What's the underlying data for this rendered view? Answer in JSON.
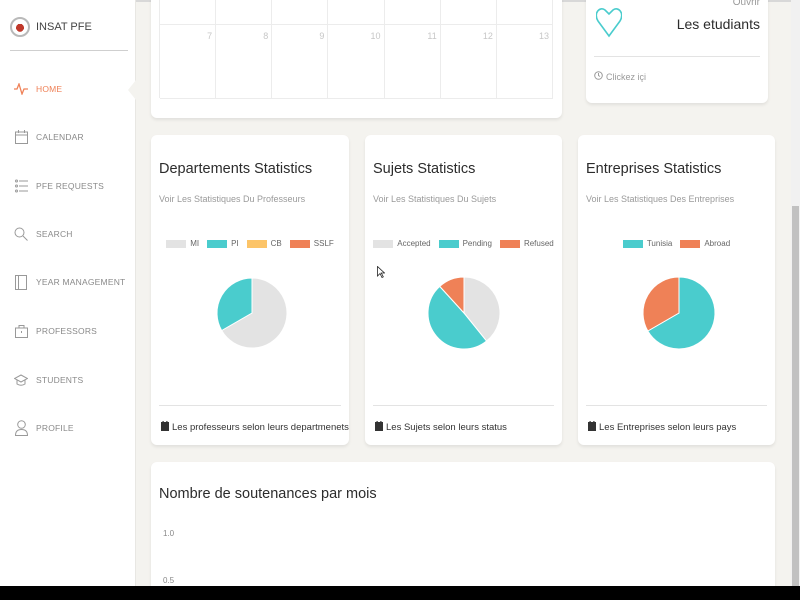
{
  "app": {
    "title": "INSAT PFE"
  },
  "sidebar": {
    "items": [
      {
        "label": "HOME",
        "icon": "heartbeat-icon",
        "active": true
      },
      {
        "label": "CALENDAR",
        "icon": "calendar-icon"
      },
      {
        "label": "PFE REQUESTS",
        "icon": "list-icon"
      },
      {
        "label": "SEARCH",
        "icon": "search-icon"
      },
      {
        "label": "YEAR MANAGEMENT",
        "icon": "book-icon"
      },
      {
        "label": "PROFESSORS",
        "icon": "briefcase-icon"
      },
      {
        "label": "STUDENTS",
        "icon": "graduation-cap-icon"
      },
      {
        "label": "PROFILE",
        "icon": "user-icon"
      }
    ]
  },
  "calendar": {
    "days": [
      "7",
      "8",
      "9",
      "10",
      "11",
      "12",
      "13"
    ]
  },
  "students_card": {
    "action": "Ouvrir",
    "title": "Les etudiants",
    "footer": "Clickez içi",
    "icon": "heart-icon"
  },
  "departements": {
    "title": "Departements Statistics",
    "subtitle": "Voir Les Statistiques Du Professeurs",
    "footer": "Les professeurs selon leurs departmenets"
  },
  "sujets": {
    "title": "Sujets Statistics",
    "subtitle": "Voir Les Statistiques Du Sujets",
    "footer": "Les Sujets selon leurs status"
  },
  "entreprises": {
    "title": "Entreprises Statistics",
    "subtitle": "Voir Les Statistiques Des Entreprises",
    "footer": "Les Entreprises selon leurs pays"
  },
  "soutenances": {
    "title": "Nombre de soutenances par mois"
  },
  "colors": {
    "accent": "#ef8157",
    "teal": "#4acccd",
    "grey": "#e3e3e3",
    "yellow": "#fcc468"
  },
  "chart_data": [
    {
      "type": "pie",
      "categories": [
        "MI",
        "PI",
        "CB",
        "SSLF"
      ],
      "values": [
        2,
        1,
        0,
        0
      ],
      "colors": [
        "#e3e3e3",
        "#4acccd",
        "#fcc468",
        "#ef8157"
      ]
    },
    {
      "type": "pie",
      "categories": [
        "Accepted",
        "Pending",
        "Refused"
      ],
      "values": [
        4,
        5,
        1.2
      ],
      "colors": [
        "#e3e3e3",
        "#4acccd",
        "#ef8157"
      ]
    },
    {
      "type": "pie",
      "categories": [
        "Tunisia",
        "Abroad"
      ],
      "values": [
        2,
        1
      ],
      "colors": [
        "#4acccd",
        "#ef8157"
      ]
    },
    {
      "type": "line",
      "title": "Nombre de soutenances par mois",
      "yticks": [
        "1.0",
        "0.5"
      ]
    }
  ]
}
